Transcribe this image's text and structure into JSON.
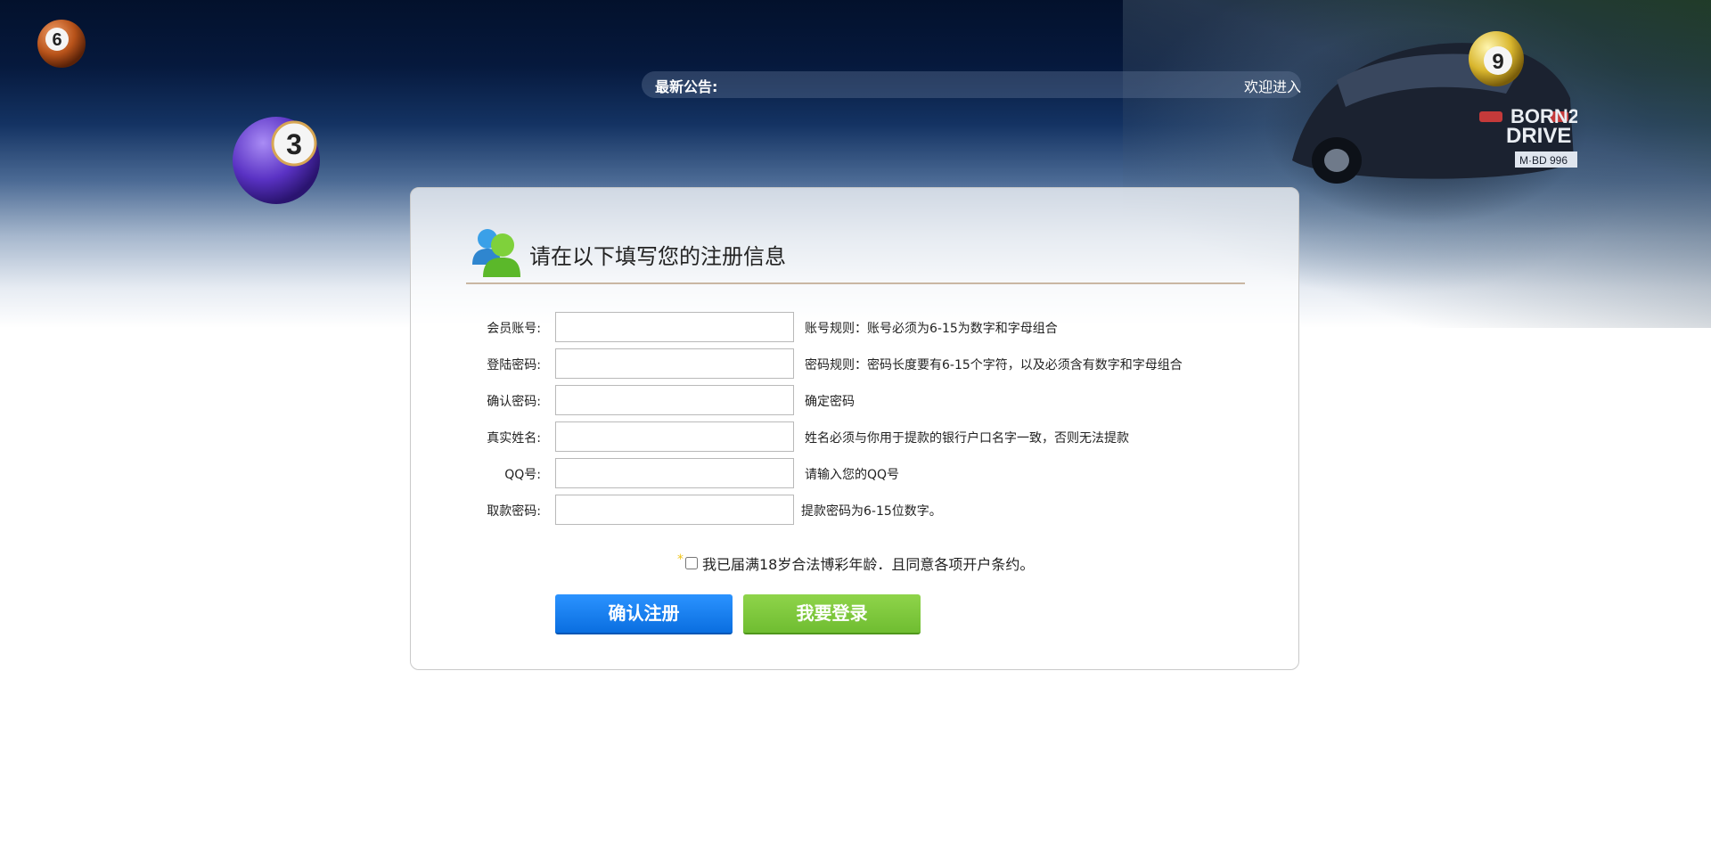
{
  "header": {
    "notice_label": "最新公告:",
    "welcome_text": "欢迎进入"
  },
  "balls": {
    "ball_6": "6",
    "ball_3": "3",
    "ball_9": "9"
  },
  "car_badge": {
    "line1": "BORN2",
    "line2": "DRIVE",
    "plate": "M·BD 996"
  },
  "form": {
    "title": "请在以下填写您的注册信息",
    "rows": [
      {
        "label": "会员账号:",
        "value": "",
        "hint": "账号规则：账号必须为6-15为数字和字母组合"
      },
      {
        "label": "登陆密码:",
        "value": "",
        "hint": "密码规则：密码长度要有6-15个字符，以及必须含有数字和字母组合"
      },
      {
        "label": "确认密码:",
        "value": "",
        "hint": "确定密码"
      },
      {
        "label": "真实姓名:",
        "value": "",
        "hint": "姓名必须与你用于提款的银行户口名字一致，否则无法提款"
      },
      {
        "label": "QQ号:",
        "value": "",
        "hint": "请输入您的QQ号"
      },
      {
        "label": "取款密码:",
        "value": "",
        "hint": "提款密码为6-15位数字。"
      }
    ],
    "required_mark": "*",
    "agreement_text": "我已届满18岁合法博彩年龄．且同意各项开户条约。",
    "register_button": "确认注册",
    "login_button": "我要登录"
  },
  "colors": {
    "register_button": "#0a6ee0",
    "login_button": "#6fbd31",
    "title_rule": "#c9b7a3"
  }
}
